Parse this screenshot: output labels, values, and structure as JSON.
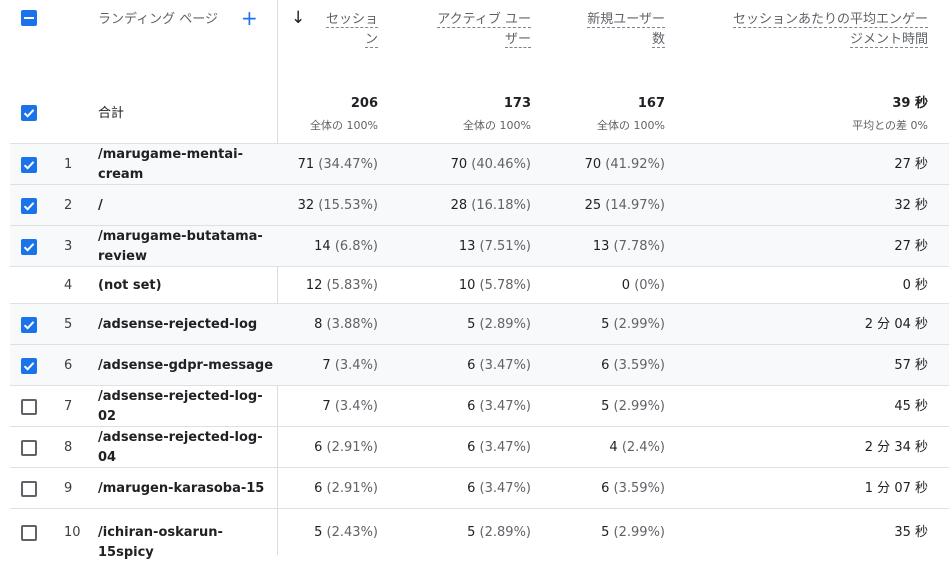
{
  "header": {
    "landing_page": "ランディング ページ",
    "add_icon": "+",
    "sort_icon": "↓",
    "sessions_l1": "セッショ",
    "sessions_l2": "ン",
    "active_users_l1": "アクティブ ユー",
    "active_users_l2": "ザー",
    "new_users_l1": "新規ユーザー",
    "new_users_l2": "数",
    "engagement_l1": "セッションあたりの平均エンゲー",
    "engagement_l2": "ジメント時間"
  },
  "totals": {
    "label": "合計",
    "sessions": "206",
    "sessions_sub": "全体の 100%",
    "active_users": "173",
    "active_users_sub": "全体の 100%",
    "new_users": "167",
    "new_users_sub": "全体の 100%",
    "engagement": "39 秒",
    "engagement_sub": "平均との差 0%"
  },
  "rows": [
    {
      "checked": true,
      "idx": "1",
      "page_l1": "/marugame-mentai-",
      "page_l2": "cream",
      "sessions": "71",
      "sessions_pct": "(34.47%)",
      "active": "70",
      "active_pct": "(40.46%)",
      "new": "70",
      "new_pct": "(41.92%)",
      "eng": "27 秒"
    },
    {
      "checked": true,
      "idx": "2",
      "page_l1": "/",
      "page_l2": "",
      "sessions": "32",
      "sessions_pct": "(15.53%)",
      "active": "28",
      "active_pct": "(16.18%)",
      "new": "25",
      "new_pct": "(14.97%)",
      "eng": "32 秒"
    },
    {
      "checked": true,
      "idx": "3",
      "page_l1": "/marugame-butatama-",
      "page_l2": "review",
      "sessions": "14",
      "sessions_pct": "(6.8%)",
      "active": "13",
      "active_pct": "(7.51%)",
      "new": "13",
      "new_pct": "(7.78%)",
      "eng": "27 秒"
    },
    {
      "checked": null,
      "idx": "4",
      "page_l1": "(not set)",
      "page_l2": "",
      "sessions": "12",
      "sessions_pct": "(5.83%)",
      "active": "10",
      "active_pct": "(5.78%)",
      "new": "0",
      "new_pct": "(0%)",
      "eng": "0 秒"
    },
    {
      "checked": true,
      "idx": "5",
      "page_l1": "/adsense-rejected-log",
      "page_l2": "",
      "sessions": "8",
      "sessions_pct": "(3.88%)",
      "active": "5",
      "active_pct": "(2.89%)",
      "new": "5",
      "new_pct": "(2.99%)",
      "eng": "2 分 04 秒"
    },
    {
      "checked": true,
      "idx": "6",
      "page_l1": "/adsense-gdpr-message",
      "page_l2": "",
      "sessions": "7",
      "sessions_pct": "(3.4%)",
      "active": "6",
      "active_pct": "(3.47%)",
      "new": "6",
      "new_pct": "(3.59%)",
      "eng": "57 秒"
    },
    {
      "checked": false,
      "idx": "7",
      "page_l1": "/adsense-rejected-log-",
      "page_l2": "02",
      "sessions": "7",
      "sessions_pct": "(3.4%)",
      "active": "6",
      "active_pct": "(3.47%)",
      "new": "5",
      "new_pct": "(2.99%)",
      "eng": "45 秒"
    },
    {
      "checked": false,
      "idx": "8",
      "page_l1": "/adsense-rejected-log-",
      "page_l2": "04",
      "sessions": "6",
      "sessions_pct": "(2.91%)",
      "active": "6",
      "active_pct": "(3.47%)",
      "new": "4",
      "new_pct": "(2.4%)",
      "eng": "2 分 34 秒"
    },
    {
      "checked": false,
      "idx": "9",
      "page_l1": "/marugen-karasoba-15",
      "page_l2": "",
      "sessions": "6",
      "sessions_pct": "(2.91%)",
      "active": "6",
      "active_pct": "(3.47%)",
      "new": "6",
      "new_pct": "(3.59%)",
      "eng": "1 分 07 秒"
    },
    {
      "checked": false,
      "idx": "10",
      "page_l1": "/ichiran-oskarun-15spicy",
      "page_l2": "",
      "sessions": "5",
      "sessions_pct": "(2.43%)",
      "active": "5",
      "active_pct": "(2.89%)",
      "new": "5",
      "new_pct": "(2.99%)",
      "eng": "35 秒"
    }
  ]
}
